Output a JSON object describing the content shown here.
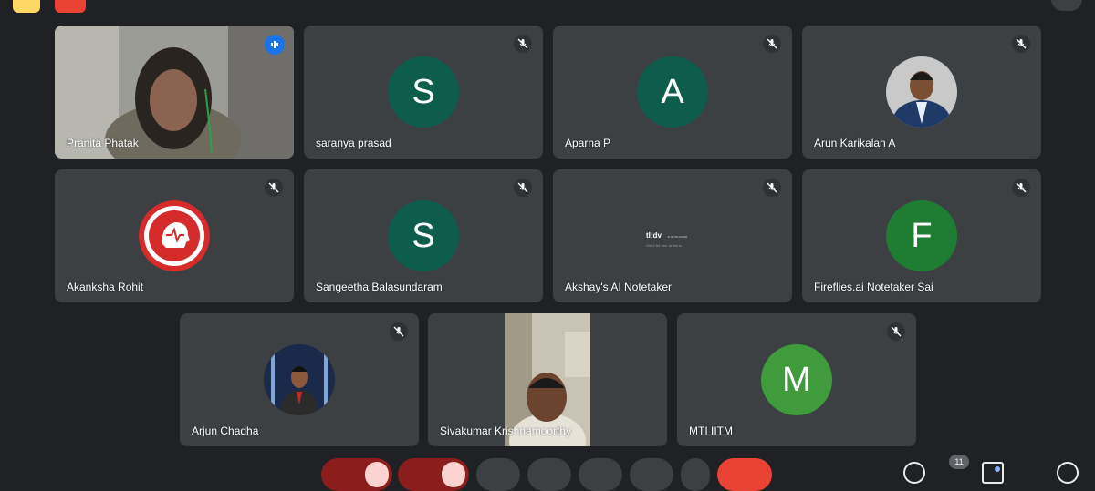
{
  "participants": [
    {
      "name": "Pranita Phatak"
    },
    {
      "name": "saranya prasad",
      "initial": "S"
    },
    {
      "name": "Aparna P",
      "initial": "A"
    },
    {
      "name": "Arun Karikalan A"
    },
    {
      "name": "Akanksha Rohit"
    },
    {
      "name": "Sangeetha Balasundaram",
      "initial": "S"
    },
    {
      "name": "Akshay's AI Notetaker",
      "logo": "tl;dv",
      "logo_tag": "AI NOTETAKER",
      "logo_sub": "Get it for free at tldv.io"
    },
    {
      "name": "Fireflies.ai Notetaker Sai",
      "initial": "F"
    },
    {
      "name": "Arjun Chadha"
    },
    {
      "name": "Sivakumar Krishnamoorthy"
    },
    {
      "name": "MTI IITM",
      "initial": "M"
    }
  ],
  "controls": {
    "participant_count": "11"
  },
  "colors": {
    "active_border": "#8ab4f8",
    "avatar_teal": "#0d5c4c",
    "avatar_green": "#1e7d32",
    "avatar_lightgreen": "#3f9b3c",
    "end_call": "#ea4335"
  }
}
